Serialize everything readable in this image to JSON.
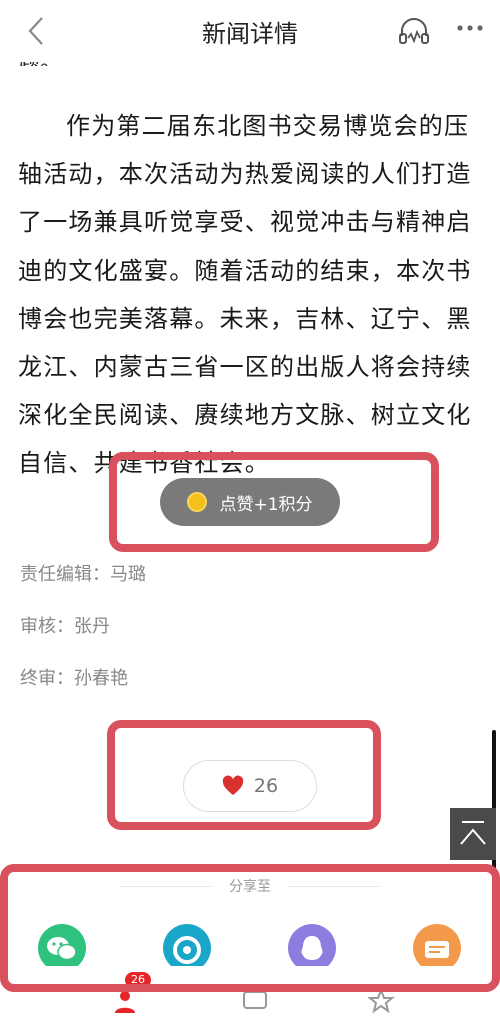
{
  "header": {
    "title": "新闻详情"
  },
  "article": {
    "partial_line": "题。",
    "paragraph": "作为第二届东北图书交易博览会的压轴活动，本次活动为热爱阅读的人们打造了一场兼具听觉享受、视觉冲击与精神启迪的文化盛宴。随着活动的结束，本次书博会也完美落幕。未来，吉林、辽宁、黑龙江、内蒙古三省一区的出版人将会持续深化全民阅读、赓续地方文脉、树立文化自信、共建书香社会。"
  },
  "points_toast": {
    "label": "点赞+1积分"
  },
  "credits": {
    "editor": "责任编辑：马璐",
    "reviewer": "审核：张丹",
    "final": "终审：孙春艳"
  },
  "like": {
    "count": "26"
  },
  "share": {
    "title": "分享至"
  },
  "bottom_nav": {
    "badge": "26"
  },
  "colors": {
    "highlight": "#d9515c",
    "wechat": "#2ec27e",
    "moments": "#1aa6c8",
    "qq": "#8f7ce0",
    "card": "#f39a4a",
    "badge": "#e5252a"
  }
}
